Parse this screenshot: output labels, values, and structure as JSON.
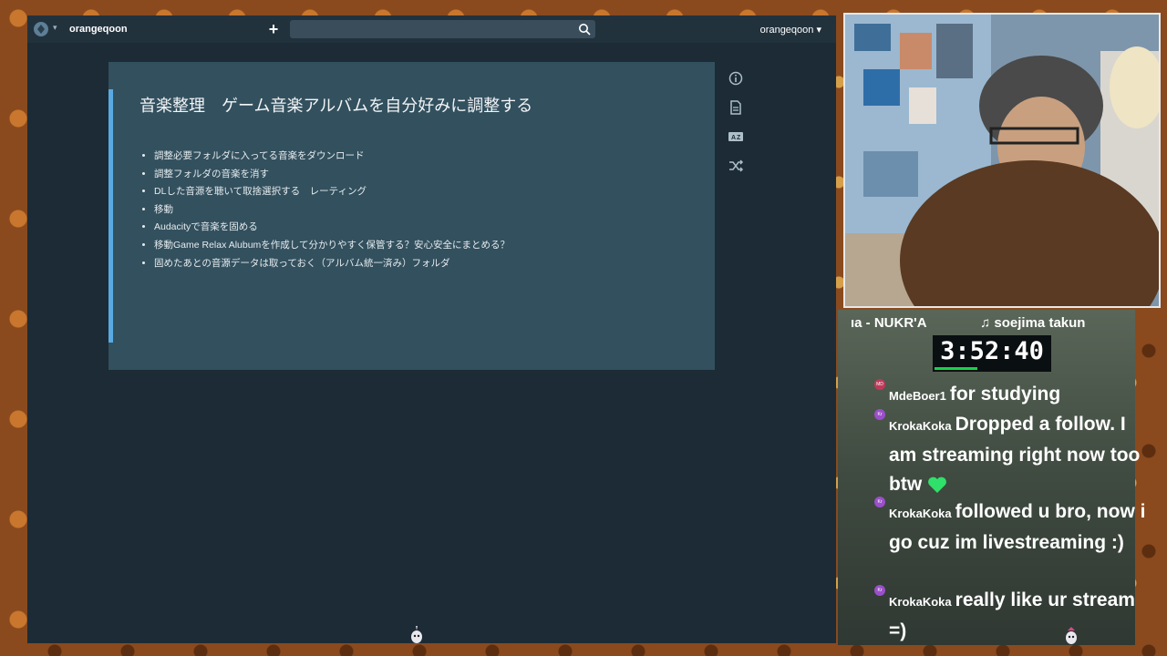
{
  "app": {
    "username_left": "orangeqoon",
    "username_right": "orangeqoon",
    "search_placeholder": "",
    "colors": {
      "background": "#1c2b35",
      "card": "#33505e",
      "accent": "#5aa9e2",
      "topbar": "#22323d"
    }
  },
  "note": {
    "title": "音楽整理　ゲーム音楽アルバムを自分好みに調整する",
    "items": [
      "調整必要フォルダに入ってる音楽をダウンロード",
      "調整フォルダの音楽を消す",
      "DLした音源を聴いて取捨選択する　レーティング",
      "移動",
      "Audacityで音楽を固める",
      "移動Game Relax Alubumを作成して分かりやすく保管する？安心安全にまとめる？",
      "固めたあとの音源データは取っておく（アルバム統一済み）フォルダ"
    ]
  },
  "side_icons": [
    "info-icon",
    "document-icon",
    "translate-icon",
    "shuffle-icon"
  ],
  "stream": {
    "now_playing_left": "ıa - NUKR'A",
    "now_playing_right": "♫ soejima takun",
    "timer": "3:52:40",
    "timer_progress": 0.37,
    "chat": [
      {
        "badge": "MD",
        "badge_color": "#c0395a",
        "user": "MdeBoer1",
        "text": "for studying"
      },
      {
        "badge": "Kr",
        "badge_color": "#9b4fc9",
        "user": "KrokaKoka",
        "text": "Dropped a follow. I am streaming right now too btw"
      },
      {
        "badge": "Kr",
        "badge_color": "#9b4fc9",
        "user": "KrokaKoka",
        "text": "followed u bro, now i go cuz im livestreaming :)"
      },
      {
        "badge": "Kr",
        "badge_color": "#9b4fc9",
        "user": "KrokaKoka",
        "text": "really like ur stream =)"
      }
    ]
  }
}
